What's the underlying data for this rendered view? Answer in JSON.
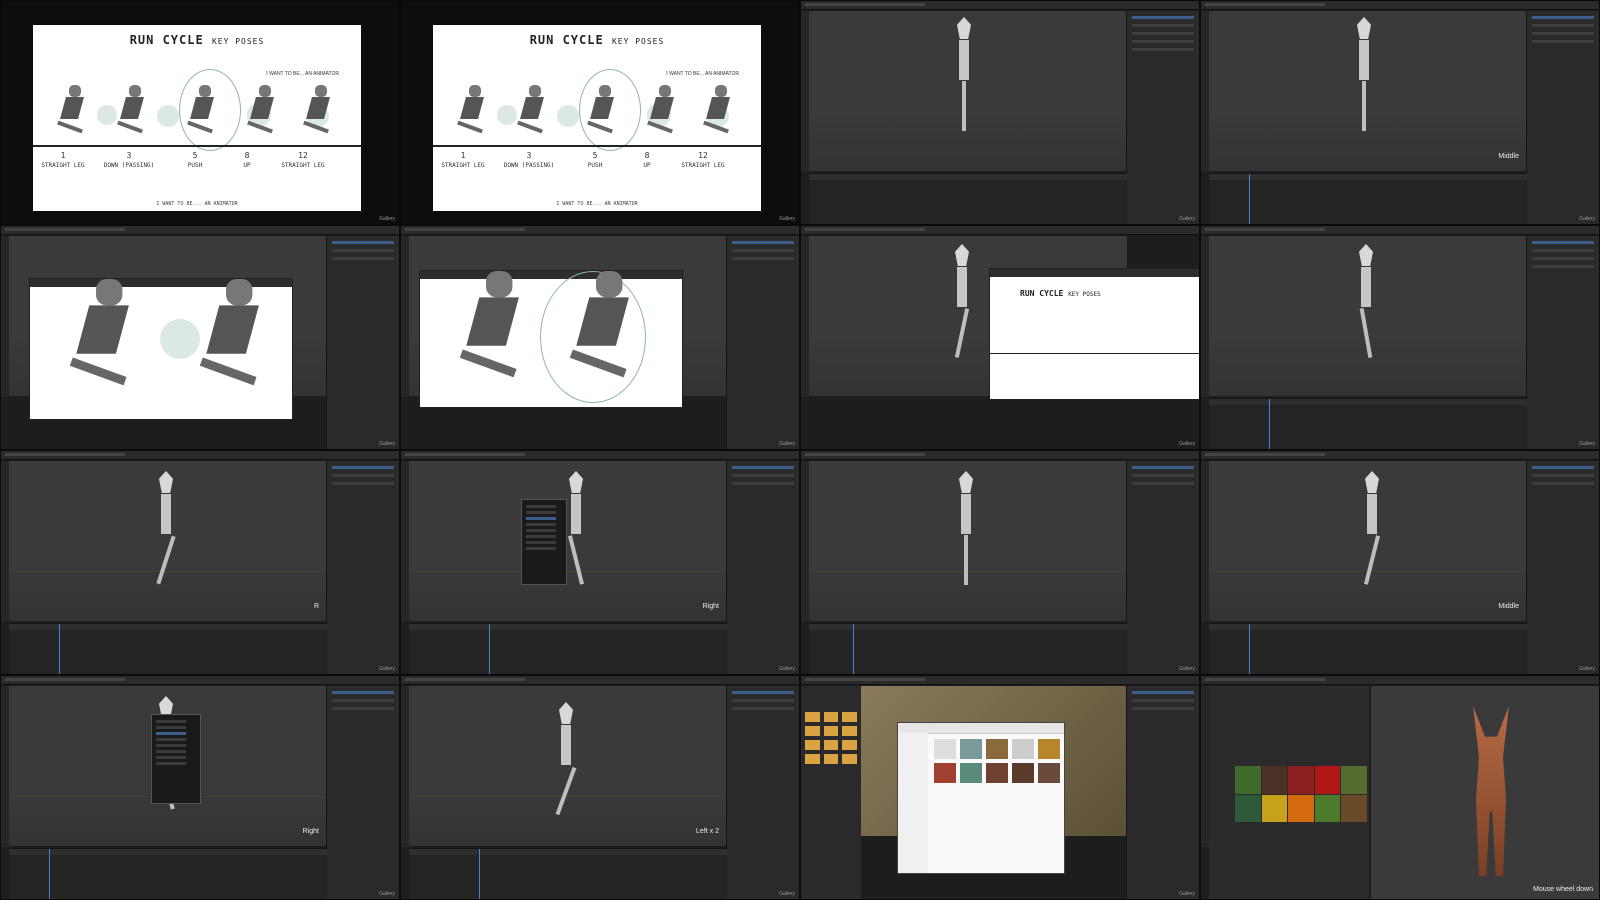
{
  "slide": {
    "title": "RUN CYCLE",
    "title_suffix": "KEY POSES",
    "footer": "I WANT TO BE... AN ANIMATOR",
    "brand": "I WANT TO BE... AN ANIMATOR",
    "keys": [
      {
        "number": "1",
        "label": "STRAIGHT LEG"
      },
      {
        "number": "3",
        "label": "DOWN (PASSING)"
      },
      {
        "number": "5",
        "label": "PUSH"
      },
      {
        "number": "8",
        "label": "UP"
      },
      {
        "number": "12",
        "label": "STRAIGHT LEG"
      }
    ]
  },
  "overlays": {
    "gallery": "Gallery",
    "middle": "Middle",
    "right": "Right",
    "left_x2": "Left x 2",
    "mouse_wheel_down": "Mouse wheel down"
  },
  "colors": {
    "bg": "#1d1d1d",
    "viewport": "#3a3a3a",
    "accent_blue": "#3b5d8a",
    "playhead": "#4a7fd6",
    "fox": "#b86b45"
  },
  "textures": [
    "#3f6b2a",
    "#4a3226",
    "#8c1f1f",
    "#b01616",
    "#556b2f",
    "#2f5a3a",
    "#c9a21b",
    "#d46a10",
    "#4e7a2c",
    "#6b4a2a"
  ]
}
